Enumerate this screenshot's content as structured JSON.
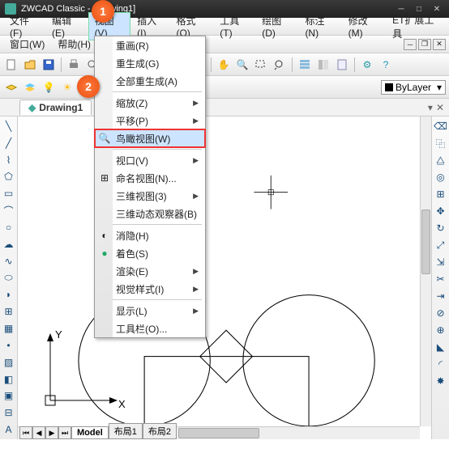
{
  "title": "ZWCAD Classic - [Drawing1]",
  "menu1": {
    "file": "文件(F)",
    "edit": "编辑(E)",
    "view": "视图(V)",
    "insert": "插入(I)",
    "format": "格式(O)",
    "tools": "工具(T)",
    "draw": "绘图(D)",
    "dim": "标注(N)",
    "modify": "修改(M)",
    "ext": "ET扩展工具"
  },
  "menu2": {
    "window": "窗口(W)",
    "help": "帮助(H)"
  },
  "layer_selector": "ByLayer",
  "doc_tab": "Drawing1",
  "dropdown": {
    "redraw": "重画(R)",
    "regen": "重生成(G)",
    "regenall": "全部重生成(A)",
    "zoom": "缩放(Z)",
    "pan": "平移(P)",
    "aerial": "鸟瞰视图(W)",
    "viewport": "视口(V)",
    "named": "命名视图(N)...",
    "view3d": "三维视图(3)",
    "orbit": "三维动态观察器(B)",
    "hide": "消隐(H)",
    "shade": "着色(S)",
    "render": "渲染(E)",
    "vstyle": "视觉样式(I)",
    "display": "显示(L)",
    "toolbar": "工具栏(O)..."
  },
  "callouts": {
    "one": "1",
    "two": "2"
  },
  "bottom_tabs": {
    "model": "Model",
    "layout1": "布局1",
    "layout2": "布局2"
  },
  "axis": {
    "x": "X",
    "y": "Y"
  },
  "chart_data": null
}
